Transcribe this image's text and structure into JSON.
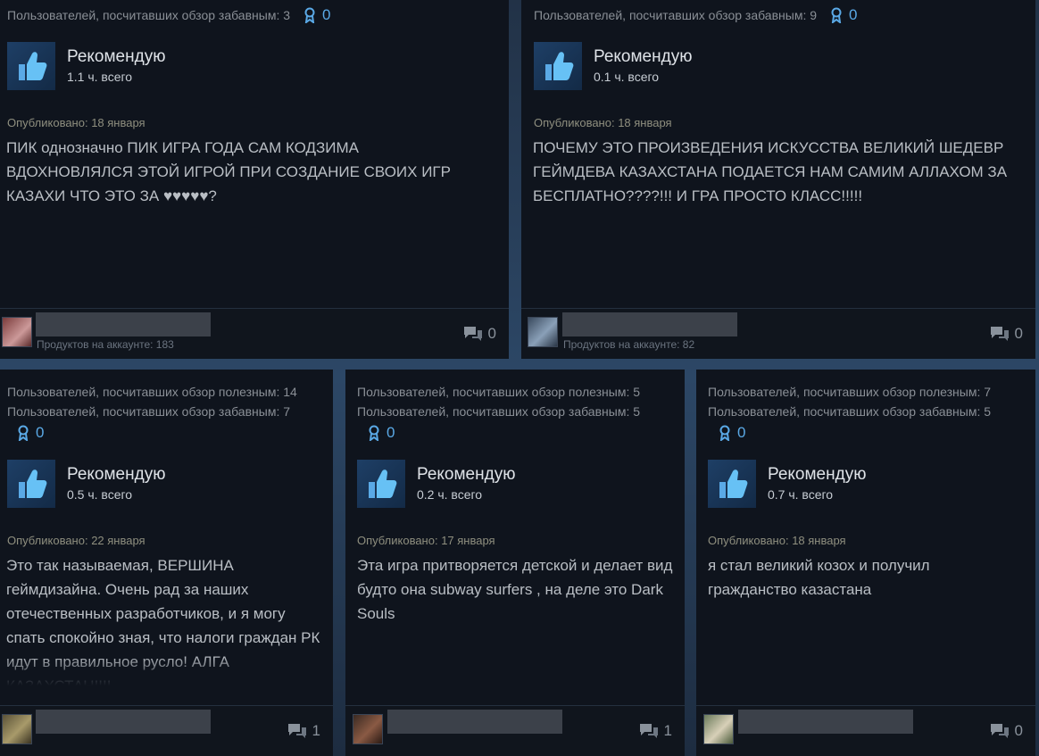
{
  "colors": {
    "card_bg": "#0f141d",
    "accent": "#5aa9e6",
    "text": "#b9bec4"
  },
  "icons": {
    "thumb": "thumbs-up-icon",
    "award": "award-icon",
    "comments": "comment-icon"
  },
  "reviews": [
    {
      "funny": "Пользователей, посчитавших обзор забавным: 3",
      "awards": "0",
      "verdict": "Рекомендую",
      "hours": "1.1 ч. всего",
      "posted": "Опубликовано: 18 января",
      "body": "ПИК однозначно ПИК ИГРА ГОДА САМ КОДЗИМА ВДОХНОВЛЯЛСЯ ЭТОЙ ИГРОЙ ПРИ СОЗДАНИЕ СВОИХ ИГР КАЗАХИ ЧТО ЭТО ЗА ♥♥♥♥♥?",
      "products": "Продуктов на аккаунте: 183",
      "comments": "0"
    },
    {
      "funny": "Пользователей, посчитавших обзор забавным: 9",
      "awards": "0",
      "verdict": "Рекомендую",
      "hours": "0.1 ч. всего",
      "posted": "Опубликовано: 18 января",
      "body": "ПОЧЕМУ ЭТО ПРОИЗВЕДЕНИЯ ИСКУССТВА ВЕЛИКИЙ ШЕДЕВР ГЕЙМДЕВА КАЗАХСТАНА ПОДАЕТСЯ НАМ САМИМ АЛЛАХОМ ЗА БЕСПЛАТНО????!!! И ГРА ПРОСТО КЛАСС!!!!!",
      "products": "Продуктов на аккаунте: 82",
      "comments": "0"
    },
    {
      "helpful": "Пользователей, посчитавших обзор полезным: 14",
      "funny": "Пользователей, посчитавших обзор забавным: 7",
      "awards": "0",
      "verdict": "Рекомендую",
      "hours": "0.5 ч. всего",
      "posted": "Опубликовано: 22 января",
      "body": "Это так называемая, ВЕРШИНА геймдизайна. Очень рад за наших отечественных разработчиков, и я могу спать спокойно зная, что налоги граждан РК идут в правильное русло! АЛГА КАЗАХСТАН!!!!",
      "comments": "1"
    },
    {
      "helpful": "Пользователей, посчитавших обзор полезным: 5",
      "funny": "Пользователей, посчитавших обзор забавным: 5",
      "awards": "0",
      "verdict": "Рекомендую",
      "hours": "0.2 ч. всего",
      "posted": "Опубликовано: 17 января",
      "body": "Эта игра притворяется детской и делает вид будто она subway surfers , на деле это Dark Souls",
      "comments": "1"
    },
    {
      "helpful": "Пользователей, посчитавших обзор полезным: 7",
      "funny": "Пользователей, посчитавших обзор забавным: 5",
      "awards": "0",
      "verdict": "Рекомендую",
      "hours": "0.7 ч. всего",
      "posted": "Опубликовано: 18 января",
      "body": "я стал великий козох и получил гражданство казастана",
      "comments": "0"
    }
  ]
}
